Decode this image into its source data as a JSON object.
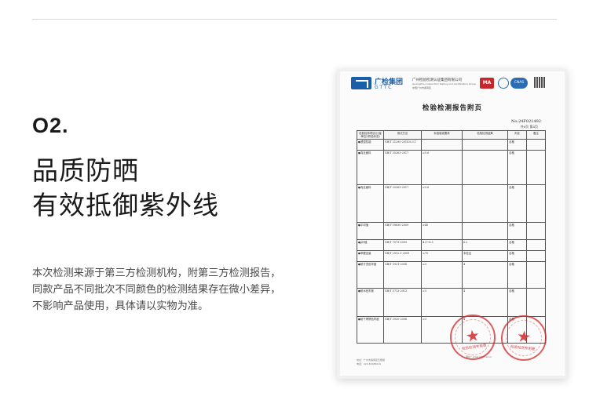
{
  "section": {
    "number": "O2.",
    "heading_line1": "品质防晒",
    "heading_line2": "有效抵御紫外线",
    "description_lines": [
      "本次检测来源于第三方检测机构，附第三方检测报告，",
      "同款产品不同批次不同颜色的检测结果存在微小差异，",
      "不影响产品使用，具体请以实物为准。"
    ]
  },
  "report": {
    "org_name": "广检集团",
    "org_abbr": "GTTC",
    "institute": "广州检验检测认证集团有限公司",
    "institute_sub": "Guangzhou Inspection Testing and Certification Group",
    "institute_sub2": "中国广州市番禺区",
    "cert_ma": "MA",
    "cert_cnas": "CNAS",
    "title": "检验检测报告附页",
    "report_no": "No:24F021492",
    "page_info": "共6页 第4页",
    "columns": [
      "检验检测项目(计量单位)(样品状态)",
      "测试方法",
      "标准值或要求",
      "检验检测结果",
      "判定",
      "备注"
    ],
    "rows": [
      [
        "●"
      ],
      [
        "●透湿性能",
        "GB/T 21295-2014 6.3.1",
        "",
        "",
        "合格",
        ""
      ],
      [
        "●真丝面料",
        "GB/T 35263-2017",
        "≥5.6",
        "",
        "合格",
        ""
      ],
      [
        "●平均值",
        "GB/T 18830-2009",
        "≥40",
        "",
        "合格",
        ""
      ],
      [
        "●pH值",
        "GB/T 7573-2009",
        "4.0~8.5",
        "6.2",
        "合格",
        ""
      ],
      [
        "●甲醛含量",
        "GB/T 2912.1-2009",
        "≤75",
        "未检出",
        "合格",
        ""
      ],
      [
        "●耐汗渍色牢度",
        "GB/T 3921-2008",
        "≥3",
        "4",
        "合格",
        ""
      ],
      [
        "●耐水色牢度",
        "GB/T 5713-2013",
        "≥3",
        "4",
        "合格",
        ""
      ],
      [
        "●耐干摩擦色牢度",
        "GB/T 3920-2008",
        "≥3",
        "4",
        "合格",
        ""
      ]
    ],
    "footer_left": "地址：广州市番禺区石楼镇",
    "footer_left2": "电话：020-82986610",
    "footer_right": "网址：www.gttc.net.cn",
    "stamp_text": "检验检测专用章",
    "stamp_color": "#d22828",
    "accent_blue": "#1b5fa8"
  }
}
